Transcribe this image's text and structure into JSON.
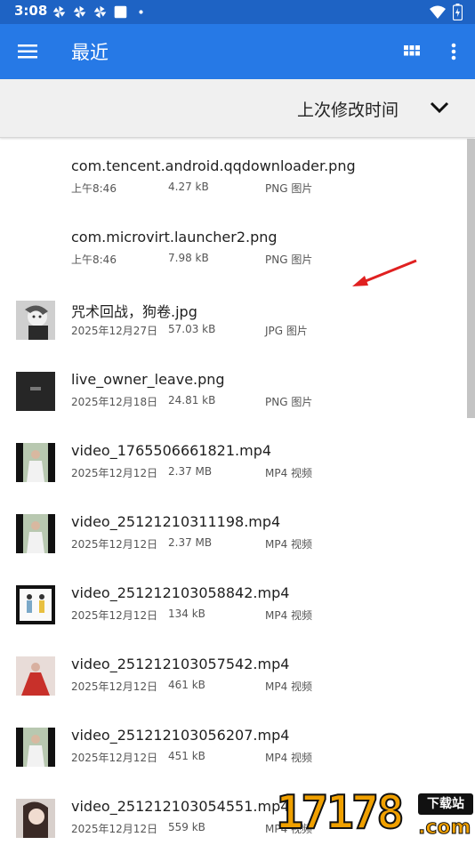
{
  "status_bar": {
    "time": "3:08",
    "notification_icons": [
      "pinwheel-icon",
      "pinwheel-icon",
      "pinwheel-icon",
      "square-icon",
      "dot-icon"
    ],
    "wifi_icon": "wifi-icon",
    "battery_icon": "battery-charging-icon"
  },
  "app_bar": {
    "title": "最近",
    "menu_icon": "hamburger-menu-icon",
    "grid_icon": "grid-view-icon",
    "more_icon": "more-vert-icon",
    "color": "#2679e6"
  },
  "sort": {
    "label": "上次修改时间",
    "chevron_icon": "chevron-down-icon"
  },
  "files": [
    {
      "name": "com.tencent.android.qqdownloader.png",
      "date": "上午8:46",
      "size": "4.27 kB",
      "type": "PNG 图片",
      "thumb": "none"
    },
    {
      "name": "com.microvirt.launcher2.png",
      "date": "上午8:46",
      "size": "7.98 kB",
      "type": "PNG 图片",
      "thumb": "none"
    },
    {
      "name": "咒术回战，狗卷.jpg",
      "date": "2025年12月27日",
      "size": "57.03 kB",
      "type": "JPG 图片",
      "thumb": "anime-portrait"
    },
    {
      "name": "live_owner_leave.png",
      "date": "2025年12月18日",
      "size": "24.81 kB",
      "type": "PNG 图片",
      "thumb": "dark-screen"
    },
    {
      "name": "video_1765506661821.mp4",
      "date": "2025年12月12日",
      "size": "2.37 MB",
      "type": "MP4 视频",
      "thumb": "video-frame-white-dress"
    },
    {
      "name": "video_25121210311198.mp4",
      "date": "2025年12月12日",
      "size": "2.37 MB",
      "type": "MP4 视频",
      "thumb": "video-frame-white-dress"
    },
    {
      "name": "video_251212103058842.mp4",
      "date": "2025年12月12日",
      "size": "134 kB",
      "type": "MP4 视频",
      "thumb": "video-frame-two-figures"
    },
    {
      "name": "video_251212103057542.mp4",
      "date": "2025年12月12日",
      "size": "461 kB",
      "type": "MP4 视频",
      "thumb": "video-frame-red-dress"
    },
    {
      "name": "video_251212103056207.mp4",
      "date": "2025年12月12日",
      "size": "451 kB",
      "type": "MP4 视频",
      "thumb": "video-frame-white-dress"
    },
    {
      "name": "video_251212103054551.mp4",
      "date": "2025年12月12日",
      "size": "559 kB",
      "type": "MP4 视频",
      "thumb": "portrait-photo"
    }
  ],
  "watermark": {
    "logo": "17178",
    "tag": "下载站",
    "domain": ".com"
  },
  "colors": {
    "status_bar": "#1e63c4",
    "app_bar": "#2679e6",
    "annotation_arrow": "#e02020",
    "watermark": "#f0a000"
  }
}
